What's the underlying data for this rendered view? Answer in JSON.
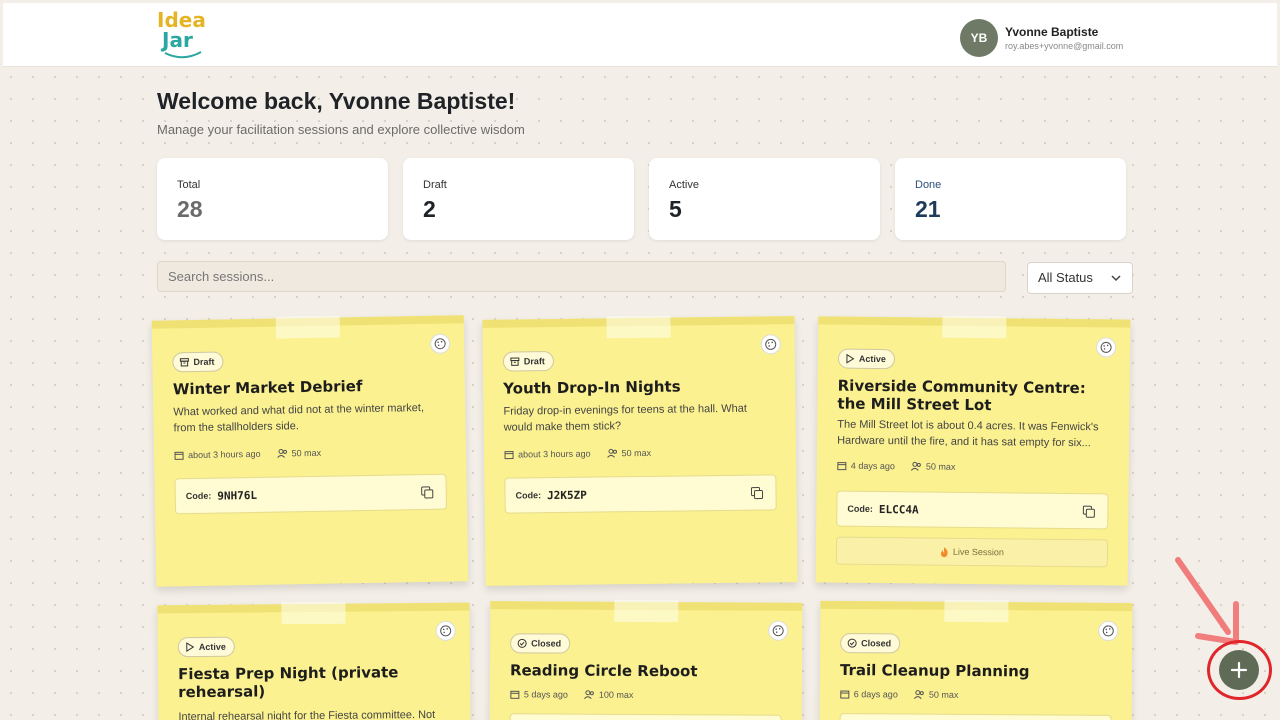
{
  "header": {
    "logo_line1": "Idea",
    "logo_line2": "Jar",
    "user": {
      "initials": "YB",
      "name": "Yvonne Baptiste",
      "email": "roy.abes+yvonne@gmail.com"
    }
  },
  "welcome": {
    "title": "Welcome back, Yvonne Baptiste!",
    "subtitle": "Manage your facilitation sessions and explore collective wisdom"
  },
  "stats": [
    {
      "label": "Total",
      "value": "28",
      "color": "#6b6b6b",
      "label_color": "#333333"
    },
    {
      "label": "Draft",
      "value": "2",
      "color": "#1f2328",
      "label_color": "#333333"
    },
    {
      "label": "Active",
      "value": "5",
      "color": "#1f2328",
      "label_color": "#333333"
    },
    {
      "label": "Done",
      "value": "21",
      "color": "#1f3b5c",
      "label_color": "#2b4f7a"
    }
  ],
  "search": {
    "placeholder": "Search sessions..."
  },
  "filter": {
    "selected": "All Status"
  },
  "code_label": "Code:",
  "cards": [
    {
      "status": "Draft",
      "status_icon": "archive-icon",
      "title": "Winter Market Debrief",
      "description": "What worked and what did not at the winter market, from the stallholders side.",
      "time": "about 3 hours ago",
      "max": "50 max",
      "code": "9NH76L"
    },
    {
      "status": "Draft",
      "status_icon": "archive-icon",
      "title": "Youth Drop-In Nights",
      "description": "Friday drop-in evenings for teens at the hall. What would make them stick?",
      "time": "about 3 hours ago",
      "max": "50 max",
      "code": "J2K5ZP"
    },
    {
      "status": "Active",
      "status_icon": "play-icon",
      "title": "Riverside Community Centre: the Mill Street Lot",
      "description": "The Mill Street lot is about 0.4 acres. It was Fenwick's Hardware until the fire, and it has sat empty for six...",
      "time": "4 days ago",
      "max": "50 max",
      "code": "ELCC4A",
      "live_label": "Live Session"
    },
    {
      "status": "Active",
      "status_icon": "play-icon",
      "title": "Fiesta Prep Night (private rehearsal)",
      "description": "Internal rehearsal night for the Fiesta committee. Not"
    },
    {
      "status": "Closed",
      "status_icon": "check-circle-icon",
      "title": "Reading Circle Reboot",
      "time": "5 days ago",
      "max": "100 max"
    },
    {
      "status": "Closed",
      "status_icon": "check-circle-icon",
      "title": "Trail Cleanup Planning",
      "time": "6 days ago",
      "max": "50 max"
    }
  ],
  "colors": {
    "note_yellow": "#fbf190",
    "accent_green": "#5f6b56",
    "highlight_red": "#e0262b"
  }
}
